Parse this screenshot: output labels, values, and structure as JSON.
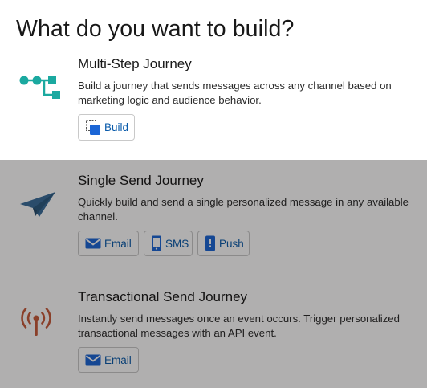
{
  "page": {
    "title": "What do you want to build?"
  },
  "multi_step": {
    "title": "Multi-Step Journey",
    "description": "Build a journey that sends messages across any channel based on marketing logic and audience behavior.",
    "build_label": "Build",
    "icon": "journey-flow-icon"
  },
  "single_send": {
    "title": "Single Send Journey",
    "description": "Quickly build and send a single personalized message in any available channel.",
    "buttons": {
      "email": "Email",
      "sms": "SMS",
      "push": "Push"
    },
    "icon": "paper-plane-icon"
  },
  "transactional": {
    "title": "Transactional Send Journey",
    "description": "Instantly send messages once an event occurs. Trigger personalized transactional messages with an API event.",
    "buttons": {
      "email": "Email"
    },
    "icon": "broadcast-tower-icon"
  },
  "colors": {
    "accent": "#0b5cab",
    "teal": "#1ba9a0",
    "plane": "#3a6e9b",
    "tower": "#c75a3a",
    "overlay": "rgba(8,7,7,0.32)"
  }
}
